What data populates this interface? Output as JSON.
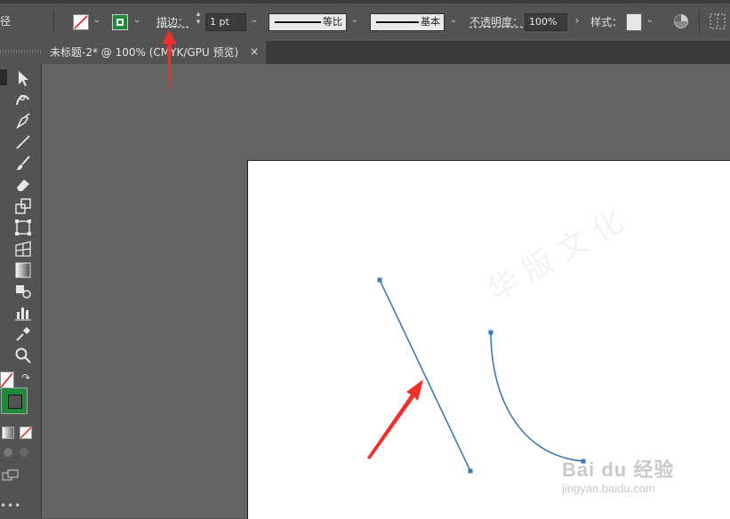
{
  "toolbar": {
    "left_cut_label": "径",
    "stroke_label": "描边：",
    "stroke_weight": "1 pt",
    "profile_label": "等比",
    "brush_label": "基本",
    "opacity_label": "不透明度：",
    "opacity_value": "100%",
    "style_label": "样式："
  },
  "document_tab": {
    "title": "未标题-2* @ 100% (CMYK/GPU 预览)",
    "close_glyph": "×"
  },
  "colors": {
    "ui_bg": "#535353",
    "canvas_bg": "#646464",
    "selection_blue": "#3d7ab8",
    "fill_green": "#1f8a3b",
    "annotation_red": "#f0302b"
  },
  "watermark": {
    "baidu_logo": "Bai du 经验",
    "baidu_url": "jingyan.baidu.com"
  }
}
